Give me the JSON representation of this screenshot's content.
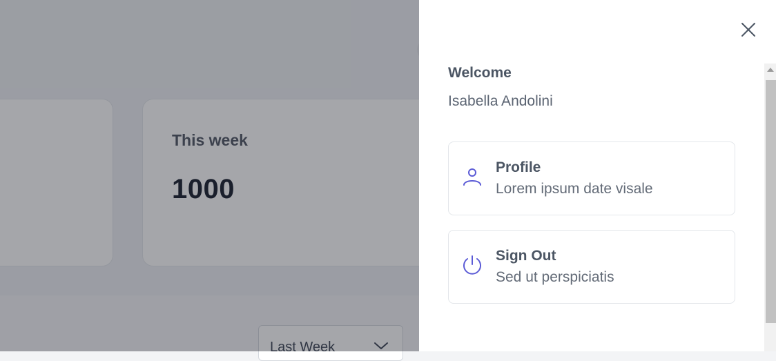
{
  "background": {
    "cards": [
      {
        "title": "",
        "value": ""
      },
      {
        "title": "This week",
        "value": "1000"
      }
    ],
    "period_select": {
      "value": "Last Week",
      "icon": "chevron-down-icon"
    }
  },
  "drawer": {
    "close_icon": "close-icon",
    "welcome": "Welcome",
    "user_name": "Isabella Andolini",
    "menu": [
      {
        "title": "Profile",
        "subtitle": "Lorem ipsum date visale",
        "icon": "user-icon"
      },
      {
        "title": "Sign Out",
        "subtitle": "Sed ut perspiciatis",
        "icon": "power-icon"
      }
    ]
  },
  "colors": {
    "accent": "#5b5bd6",
    "overlay": "#282c34"
  }
}
